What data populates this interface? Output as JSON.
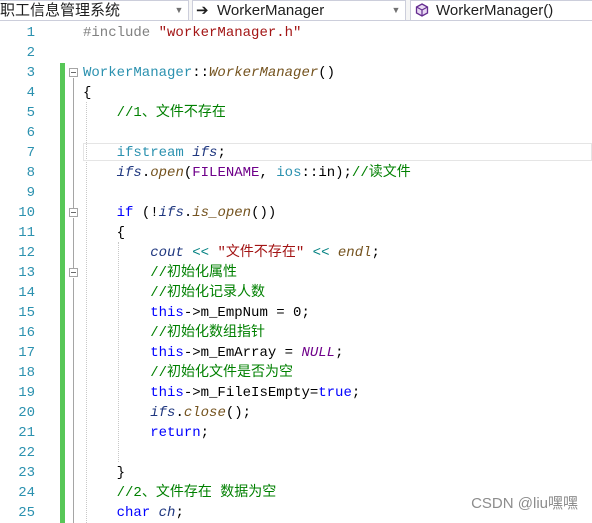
{
  "navbar": {
    "project": "职工信息管理系统",
    "scope": "WorkerManager",
    "member": "WorkerManager()"
  },
  "line_numbers": [
    "1",
    "2",
    "3",
    "4",
    "5",
    "6",
    "7",
    "8",
    "9",
    "10",
    "11",
    "12",
    "13",
    "14",
    "15",
    "16",
    "17",
    "18",
    "19",
    "20",
    "21",
    "22",
    "23",
    "24",
    "25"
  ],
  "code_lines": [
    [
      [
        "pp",
        "#include "
      ],
      [
        "s",
        "\"workerManager.h\""
      ]
    ],
    [],
    [
      [
        "t",
        "WorkerManager"
      ],
      [
        "p",
        "::"
      ],
      [
        "f",
        "WorkerManager"
      ],
      [
        "p",
        "()"
      ]
    ],
    [
      [
        "p",
        "{"
      ]
    ],
    [
      [
        "p",
        "    "
      ],
      [
        "c",
        "//1、文件不存在"
      ]
    ],
    [],
    [
      [
        "p",
        "    "
      ],
      [
        "t",
        "ifstream"
      ],
      [
        "p",
        " "
      ],
      [
        "v",
        "ifs"
      ],
      [
        "p",
        ";"
      ]
    ],
    [
      [
        "p",
        "    "
      ],
      [
        "v",
        "ifs"
      ],
      [
        "p",
        "."
      ],
      [
        "f",
        "open"
      ],
      [
        "p",
        "("
      ],
      [
        "mc",
        "FILENAME"
      ],
      [
        "p",
        ", "
      ],
      [
        "t",
        "ios"
      ],
      [
        "p",
        "::"
      ],
      [
        "p",
        "in);"
      ],
      [
        "c",
        "//读文件"
      ]
    ],
    [],
    [
      [
        "p",
        "    "
      ],
      [
        "k",
        "if"
      ],
      [
        "p",
        " (!"
      ],
      [
        "v",
        "ifs"
      ],
      [
        "p",
        "."
      ],
      [
        "f",
        "is_open"
      ],
      [
        "p",
        "())"
      ]
    ],
    [
      [
        "p",
        "    {"
      ]
    ],
    [
      [
        "p",
        "        "
      ],
      [
        "v",
        "cout"
      ],
      [
        "p",
        " "
      ],
      [
        "o",
        "<<"
      ],
      [
        "p",
        " "
      ],
      [
        "s",
        "\"文件不存在\""
      ],
      [
        "p",
        " "
      ],
      [
        "o",
        "<<"
      ],
      [
        "p",
        " "
      ],
      [
        "f",
        "endl"
      ],
      [
        "p",
        ";"
      ]
    ],
    [
      [
        "p",
        "        "
      ],
      [
        "c",
        "//初始化属性"
      ]
    ],
    [
      [
        "p",
        "        "
      ],
      [
        "c",
        "//初始化记录人数"
      ]
    ],
    [
      [
        "p",
        "        "
      ],
      [
        "k",
        "this"
      ],
      [
        "p",
        "->m_EmpNum = 0;"
      ]
    ],
    [
      [
        "p",
        "        "
      ],
      [
        "c",
        "//初始化数组指针"
      ]
    ],
    [
      [
        "p",
        "        "
      ],
      [
        "k",
        "this"
      ],
      [
        "p",
        "->m_EmArray = "
      ],
      [
        "m",
        "NULL"
      ],
      [
        "p",
        ";"
      ]
    ],
    [
      [
        "p",
        "        "
      ],
      [
        "c",
        "//初始化文件是否为空"
      ]
    ],
    [
      [
        "p",
        "        "
      ],
      [
        "k",
        "this"
      ],
      [
        "p",
        "->m_FileIsEmpty="
      ],
      [
        "k",
        "true"
      ],
      [
        "p",
        ";"
      ]
    ],
    [
      [
        "p",
        "        "
      ],
      [
        "v",
        "ifs"
      ],
      [
        "p",
        "."
      ],
      [
        "f",
        "close"
      ],
      [
        "p",
        "();"
      ]
    ],
    [
      [
        "p",
        "        "
      ],
      [
        "k",
        "return"
      ],
      [
        "p",
        ";"
      ]
    ],
    [],
    [
      [
        "p",
        "    }"
      ]
    ],
    [
      [
        "p",
        "    "
      ],
      [
        "c",
        "//2、文件存在 数据为空"
      ]
    ],
    [
      [
        "p",
        "    "
      ],
      [
        "k",
        "char"
      ],
      [
        "p",
        " "
      ],
      [
        "v",
        "ch"
      ],
      [
        "p",
        ";"
      ]
    ]
  ],
  "watermark": "CSDN @liu嘿嘿",
  "colors": {
    "keyword": "#0000ff",
    "string": "#a31515",
    "comment": "#008000",
    "type": "#2b91af",
    "function": "#74531f",
    "variable": "#1f377f",
    "macro": "#6f008a",
    "change_bar": "#57c757"
  },
  "icons": {
    "scope": "arrow-right-icon",
    "member": "method-cube-icon",
    "dropdown": "chevron-down-icon"
  }
}
